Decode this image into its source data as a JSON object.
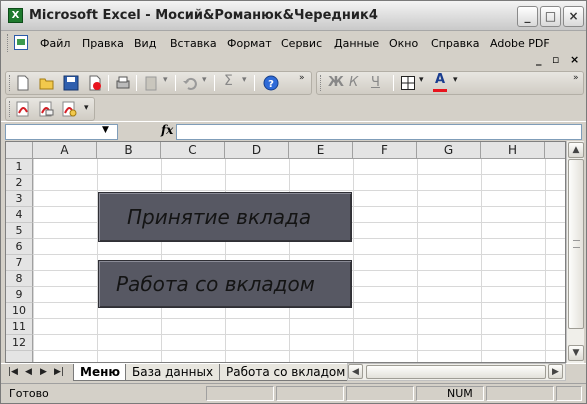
{
  "window": {
    "title": "Microsoft Excel - Мосий&Романюк&Чередник4",
    "app_icon": "excel-icon"
  },
  "menu": {
    "items": [
      "Файл",
      "Правка",
      "Вид",
      "Вставка",
      "Формат",
      "Сервис",
      "Данные",
      "Окно",
      "Справка",
      "Adobe PDF"
    ],
    "mdi_min": "_",
    "mdi_restore": "▫",
    "mdi_close": "×"
  },
  "toolbar": {
    "font_buttons": [
      "Ж",
      "К",
      "Ч"
    ],
    "sum_symbol": "Σ",
    "help_symbol": "?",
    "font_color_letter": "A"
  },
  "formula_bar": {
    "name_box": "",
    "fx_label": "fx",
    "formula": ""
  },
  "grid": {
    "columns": [
      "A",
      "B",
      "C",
      "D",
      "E",
      "F",
      "G",
      "H"
    ],
    "rows": [
      "1",
      "2",
      "3",
      "4",
      "5",
      "6",
      "7",
      "8",
      "9",
      "10",
      "11",
      "12"
    ]
  },
  "sheet_buttons": [
    {
      "label": "Принятие вклада"
    },
    {
      "label": "Работа со вкладом"
    }
  ],
  "tabs": [
    {
      "label": "Меню",
      "active": true
    },
    {
      "label": "База данных",
      "active": false
    },
    {
      "label": "Работа со вкладом",
      "active": false
    }
  ],
  "status": {
    "text": "Готово",
    "num": "NUM"
  },
  "colors": {
    "button_face": "#575863",
    "accent_red": "#e8141e"
  }
}
